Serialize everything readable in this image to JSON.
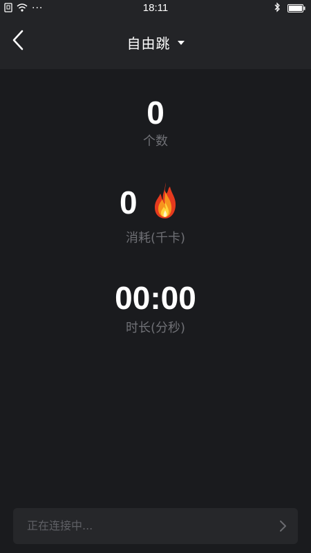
{
  "status_bar": {
    "time": "18:11",
    "left_icons": [
      "sim-icon",
      "wifi-icon",
      "more-dots-icon"
    ],
    "right_icons": [
      "bluetooth-icon",
      "battery-icon"
    ],
    "dots": "···"
  },
  "header": {
    "title": "自由跳",
    "back_icon": "chevron-left-icon",
    "dropdown_icon": "caret-down-icon"
  },
  "stats": {
    "count": {
      "value": "0",
      "label": "个数"
    },
    "calories": {
      "value": "0",
      "label": "消耗(千卡)",
      "icon": "fire-icon"
    },
    "duration": {
      "value": "00:00",
      "label": "时长(分秒)"
    }
  },
  "connection": {
    "text": "正在连接中...",
    "icon": "chevron-right-icon"
  },
  "colors": {
    "background": "#1a1b1e",
    "header_bg": "#232427",
    "label_gray": "#6f7075",
    "panel_bg": "#26272a"
  }
}
